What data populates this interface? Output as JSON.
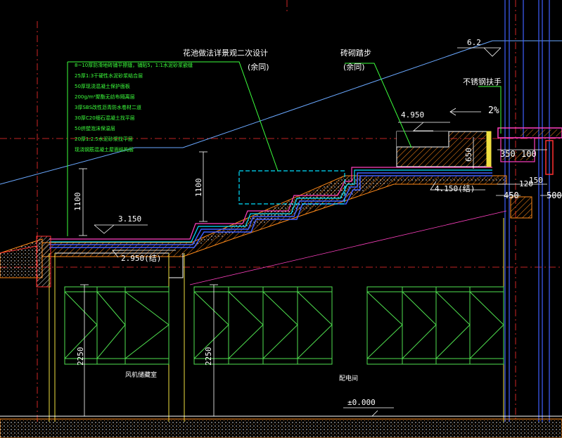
{
  "notes": {
    "planter_note": "花池做法详景观二次设计",
    "stair_note": "砖砌踏步",
    "stair_note_sub": "(余同)",
    "rail_note": "不锈钢扶手",
    "same_as": "余同",
    "room_left": "风机储藏室",
    "room_right": "配电间"
  },
  "layers": [
    "8~10厚防滑地砖铺平擦缝，铺贴5，1:1水泥砂浆嵌缝",
    "25厚1:3干硬性水泥砂浆结合层",
    "50厚现浇混凝土保护面板",
    "200g/m²聚酯无纺布隔离层",
    "3厚SBS改性沥青防水卷材二道",
    "30厚C20细石混凝土找平层",
    "50挤塑泡沫保温层",
    "20厚1:2.5水泥砂浆找平层",
    "现浇钢筋混凝土屋面结构层"
  ],
  "dims": {
    "elev_62": "6.2",
    "elev_4950": "4.950",
    "slope": "2%",
    "elev_4150": "4.150(结)",
    "elev_3150": "3.150",
    "elev_2950": "2.950(结)",
    "elev_0000": "±0.000",
    "d350": "350",
    "d100": "100",
    "d120": "120",
    "d150": "150",
    "d450": "450",
    "d500": "500",
    "d650": "650",
    "h1100a": "1100",
    "h1100b": "1100",
    "h2250a": "2250",
    "h2250b": "2250"
  },
  "colors": {
    "background": "#000000",
    "white": "#ffffff",
    "green": "#3cff3c",
    "blue": "#4060ff",
    "cyan": "#00e0ff",
    "magenta": "#ff40c0",
    "red": "#ff3030",
    "orange": "#ff8a1a",
    "yellow": "#f0e040"
  }
}
